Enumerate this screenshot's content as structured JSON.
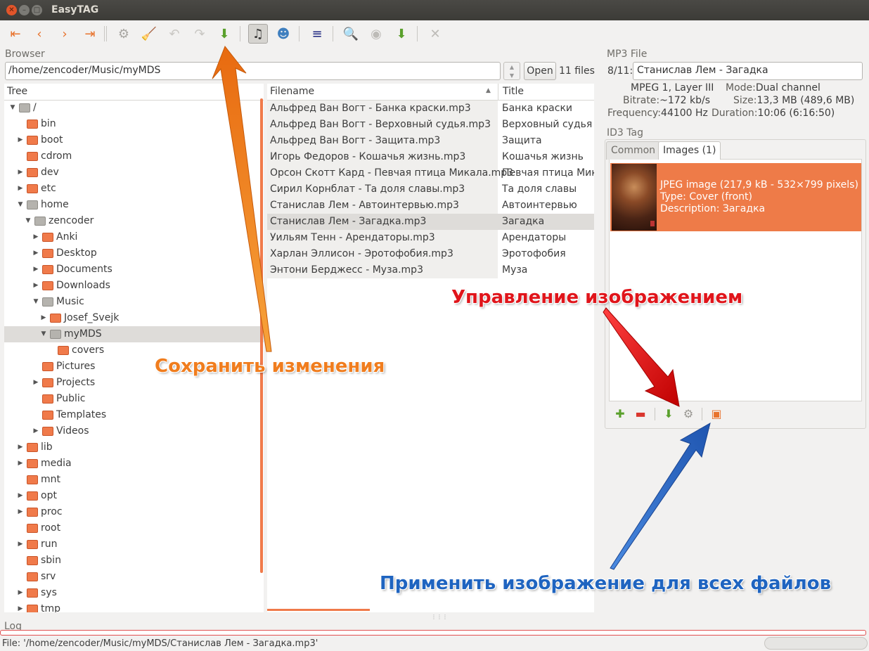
{
  "window": {
    "title": "EasyTAG"
  },
  "toolbar": {
    "buttons": [
      {
        "name": "first-file-button",
        "glyph": "⇤",
        "color": "#e8722c"
      },
      {
        "name": "prev-file-button",
        "glyph": "‹",
        "color": "#e8722c"
      },
      {
        "name": "next-file-button",
        "glyph": "›",
        "color": "#e8722c"
      },
      {
        "name": "last-file-button",
        "glyph": "⇥",
        "color": "#e8722c"
      },
      {
        "name": "scan-files-button",
        "glyph": "⚙",
        "color": "#a8a6a2"
      },
      {
        "name": "clear-button",
        "glyph": "🧹",
        "color": "#c69a3a"
      },
      {
        "name": "undo-button",
        "glyph": "↶",
        "color": "#c9c7c3"
      },
      {
        "name": "redo-button",
        "glyph": "↷",
        "color": "#c9c7c3"
      },
      {
        "name": "save-button",
        "glyph": "⬇",
        "color": "#5aa02c"
      },
      {
        "name": "browser-view-button",
        "glyph": "♫",
        "color": "#333333"
      },
      {
        "name": "artist-album-view-button",
        "glyph": "☻",
        "color": "#3f7fbf"
      },
      {
        "name": "list-view-button",
        "glyph": "≡",
        "color": "#1a237e"
      },
      {
        "name": "search-button",
        "glyph": "🔍",
        "color": "#3a5f99"
      },
      {
        "name": "cddb-button",
        "glyph": "◉",
        "color": "#bdbbb7"
      },
      {
        "name": "playlist-button",
        "glyph": "⬇",
        "color": "#5aa02c"
      },
      {
        "name": "stop-button",
        "glyph": "✕",
        "color": "#bdbbb7"
      }
    ]
  },
  "browser": {
    "label": "Browser",
    "path": "/home/zencoder/Music/myMDS",
    "open_label": "Open",
    "files_count": "11 files",
    "tree_header": "Tree",
    "tree": [
      {
        "label": "/",
        "level": 0,
        "expander": "down",
        "icon": "grey"
      },
      {
        "label": "bin",
        "level": 1,
        "expander": "",
        "icon": "orange"
      },
      {
        "label": "boot",
        "level": 1,
        "expander": "right",
        "icon": "orange"
      },
      {
        "label": "cdrom",
        "level": 1,
        "expander": "",
        "icon": "orange"
      },
      {
        "label": "dev",
        "level": 1,
        "expander": "right",
        "icon": "orange"
      },
      {
        "label": "etc",
        "level": 1,
        "expander": "right",
        "icon": "orange"
      },
      {
        "label": "home",
        "level": 1,
        "expander": "down",
        "icon": "grey"
      },
      {
        "label": "zencoder",
        "level": 2,
        "expander": "down",
        "icon": "grey"
      },
      {
        "label": "Anki",
        "level": 3,
        "expander": "right",
        "icon": "orange"
      },
      {
        "label": "Desktop",
        "level": 3,
        "expander": "right",
        "icon": "orange"
      },
      {
        "label": "Documents",
        "level": 3,
        "expander": "right",
        "icon": "orange"
      },
      {
        "label": "Downloads",
        "level": 3,
        "expander": "right",
        "icon": "orange"
      },
      {
        "label": "Music",
        "level": 3,
        "expander": "down",
        "icon": "grey"
      },
      {
        "label": "Josef_Svejk",
        "level": 4,
        "expander": "right",
        "icon": "orange"
      },
      {
        "label": "myMDS",
        "level": 4,
        "expander": "down",
        "icon": "grey",
        "selected": true
      },
      {
        "label": "covers",
        "level": 5,
        "expander": "",
        "icon": "orange"
      },
      {
        "label": "Pictures",
        "level": 3,
        "expander": "",
        "icon": "orange"
      },
      {
        "label": "Projects",
        "level": 3,
        "expander": "right",
        "icon": "orange"
      },
      {
        "label": "Public",
        "level": 3,
        "expander": "",
        "icon": "orange"
      },
      {
        "label": "Templates",
        "level": 3,
        "expander": "",
        "icon": "orange"
      },
      {
        "label": "Videos",
        "level": 3,
        "expander": "right",
        "icon": "orange"
      },
      {
        "label": "lib",
        "level": 1,
        "expander": "right",
        "icon": "orange"
      },
      {
        "label": "media",
        "level": 1,
        "expander": "right",
        "icon": "orange"
      },
      {
        "label": "mnt",
        "level": 1,
        "expander": "",
        "icon": "orange"
      },
      {
        "label": "opt",
        "level": 1,
        "expander": "right",
        "icon": "orange"
      },
      {
        "label": "proc",
        "level": 1,
        "expander": "right",
        "icon": "orange"
      },
      {
        "label": "root",
        "level": 1,
        "expander": "",
        "icon": "orange"
      },
      {
        "label": "run",
        "level": 1,
        "expander": "right",
        "icon": "orange"
      },
      {
        "label": "sbin",
        "level": 1,
        "expander": "",
        "icon": "orange"
      },
      {
        "label": "srv",
        "level": 1,
        "expander": "",
        "icon": "orange"
      },
      {
        "label": "sys",
        "level": 1,
        "expander": "right",
        "icon": "orange"
      },
      {
        "label": "tmp",
        "level": 1,
        "expander": "right",
        "icon": "orange"
      }
    ],
    "file_columns": {
      "filename": "Filename",
      "title": "Title"
    },
    "files": [
      {
        "filename": "Альфред Ван Вогт - Банка краски.mp3",
        "title": "Банка краски"
      },
      {
        "filename": "Альфред Ван Вогт - Верховный судья.mp3",
        "title": "Верховный судья"
      },
      {
        "filename": "Альфред Ван Вогт - Защита.mp3",
        "title": "Защита"
      },
      {
        "filename": "Игорь Федоров - Кошачья жизнь.mp3",
        "title": "Кошачья жизнь"
      },
      {
        "filename": "Орсон Скотт Кард - Певчая птица Микала.mp3",
        "title": "Певчая птица Микала"
      },
      {
        "filename": "Сирил Корнблат - Та доля славы.mp3",
        "title": "Та доля славы"
      },
      {
        "filename": "Станислав Лем - Автоинтервью.mp3",
        "title": "Автоинтервью"
      },
      {
        "filename": "Станислав Лем - Загадка.mp3",
        "title": "Загадка",
        "selected": true
      },
      {
        "filename": "Уильям Тенн - Арендаторы.mp3",
        "title": "Арендаторы"
      },
      {
        "filename": "Харлан Эллисон - Эротофобия.mp3",
        "title": "Эротофобия"
      },
      {
        "filename": "Энтони Берджесс - Муза.mp3",
        "title": "Муза"
      }
    ]
  },
  "mp3": {
    "label": "MP3 File",
    "track": "8/11:",
    "title": "Станислав Лем - Загадка",
    "mpeg": "MPEG 1, Layer III",
    "bitrate_key": "Bitrate:",
    "bitrate": "~172 kb/s",
    "frequency_key": "Frequency:",
    "frequency": "44100 Hz",
    "mode_key": "Mode:",
    "mode": "Dual channel",
    "size_key": "Size:",
    "size": "13,3 MB (489,6 MB)",
    "duration_key": "Duration:",
    "duration": "10:06 (6:16:50)"
  },
  "id3": {
    "label": "ID3 Tag",
    "tabs": [
      "Common",
      "Images (1)"
    ],
    "image": {
      "line1": "JPEG image (217,9 kB - 532×799 pixels)",
      "line2": "Type: Cover (front)",
      "line3": "Description: Загадка"
    },
    "image_buttons": [
      {
        "name": "add-image-button",
        "glyph": "✚",
        "color": "#5aa02c"
      },
      {
        "name": "remove-image-button",
        "glyph": "▬",
        "color": "#d9362e"
      },
      {
        "name": "save-image-button",
        "glyph": "⬇",
        "color": "#5aa02c"
      },
      {
        "name": "image-properties-button",
        "glyph": "⚙",
        "color": "#9a9893"
      },
      {
        "name": "apply-image-all-button",
        "glyph": "▣",
        "color": "#e8722c"
      }
    ]
  },
  "log": {
    "label": "Log"
  },
  "status": {
    "text": "File: '/home/zencoder/Music/myMDS/Станислав Лем - Загадка.mp3'"
  },
  "annotations": {
    "save": "Сохранить изменения",
    "image_manage": "Управление изображением",
    "apply_all": "Применить изображение для всех файлов",
    "colors": {
      "orange": "#f07d1e",
      "red": "#e0151b",
      "blue": "#1f64c0"
    }
  }
}
